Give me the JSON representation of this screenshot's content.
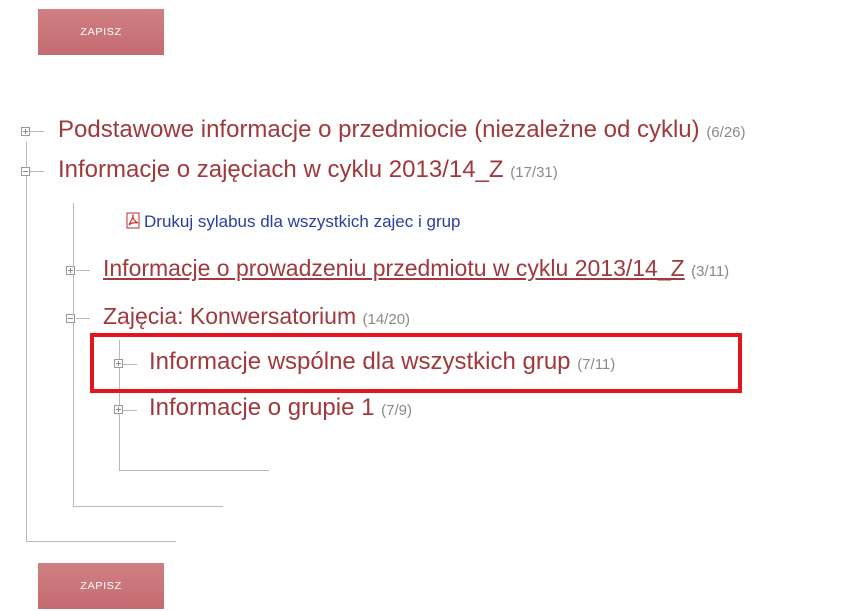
{
  "buttons": {
    "save_top": "ZAPISZ",
    "save_bottom": "ZAPISZ"
  },
  "tree": {
    "node1": {
      "label": "Podstawowe informacje o przedmiocie (niezależne od cyklu)",
      "count": "(6/26)"
    },
    "node2": {
      "label": "Informacje o zajęciach w cyklu 2013/14_Z",
      "count": "(17/31)"
    },
    "print_link": "Drukuj sylabus dla wszystkich zajec i grup",
    "node3": {
      "label": "Informacje o prowadzeniu przedmiotu w cyklu 2013/14_Z",
      "count": "(3/11)"
    },
    "node4": {
      "label": "Zajęcia: Konwersatorium",
      "count": "(14/20)"
    },
    "node5": {
      "label": "Informacje wspólne dla wszystkich grup",
      "count": "(7/11)"
    },
    "node6": {
      "label": "Informacje o grupie 1",
      "count": "(7/9)"
    }
  },
  "colors": {
    "button": "#c9767a",
    "link": "#a0393c",
    "count": "#8a8a8a",
    "highlight": "#e3141b",
    "print_link": "#2c3e9c"
  }
}
